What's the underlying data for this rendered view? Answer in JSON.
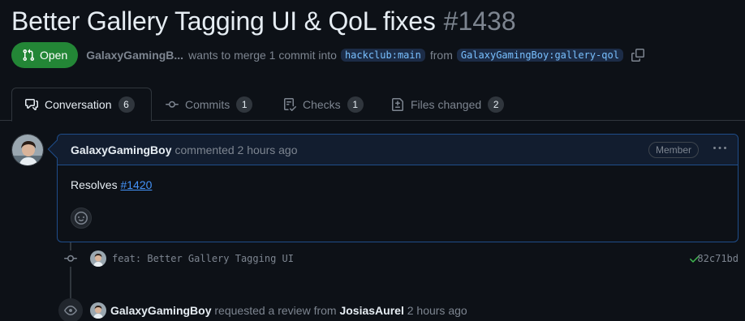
{
  "pr": {
    "title": "Better Gallery Tagging UI & QoL fixes",
    "number": "#1438",
    "state": "Open",
    "author": "GalaxyGamingB...",
    "merge_text_1": "wants to merge 1 commit into",
    "base_branch": "hackclub:main",
    "merge_text_2": "from",
    "head_branch": "GalaxyGamingBoy:gallery-qol"
  },
  "tabs": [
    {
      "label": "Conversation",
      "count": "6",
      "icon": "comment-discussion-icon",
      "active": true
    },
    {
      "label": "Commits",
      "count": "1",
      "icon": "git-commit-icon"
    },
    {
      "label": "Checks",
      "count": "1",
      "icon": "checklist-icon"
    },
    {
      "label": "Files changed",
      "count": "2",
      "icon": "file-diff-icon"
    }
  ],
  "comment": {
    "author": "GalaxyGamingBoy",
    "action": "commented 2 hours ago",
    "role": "Member",
    "body_prefix": "Resolves",
    "body_link": "#1420"
  },
  "timeline": {
    "commit_message": "feat: Better Gallery Tagging UI",
    "commit_sha": "82c71bd",
    "review_actor": "GalaxyGamingBoy",
    "review_action": "requested a review from",
    "review_target": "JosiasAurel",
    "review_time": "2 hours ago"
  },
  "colors": {
    "background": "#0d1117",
    "open_green": "#238636",
    "link_blue": "#4493f8",
    "muted": "#7d8590"
  }
}
